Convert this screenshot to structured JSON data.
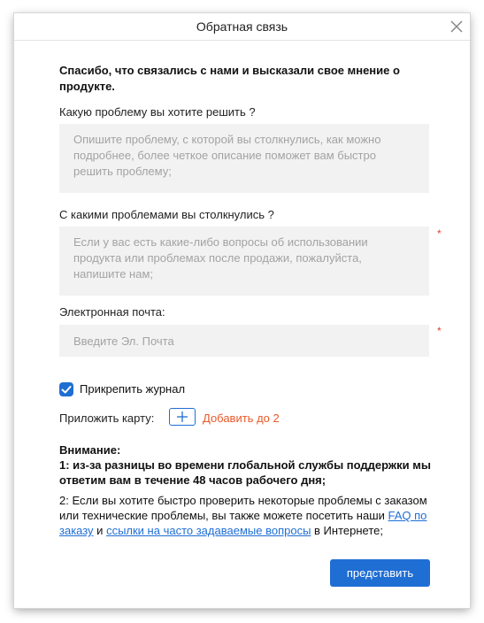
{
  "window": {
    "title": "Обратная связь",
    "close_icon": "close-icon"
  },
  "form": {
    "intro": "Спасибо, что связались с нами и высказали свое мнение о продукте.",
    "q1": {
      "label": "Какую проблему вы хотите решить ?",
      "value": "",
      "placeholder": "Опишите проблему, с которой вы столкнулись, как можно подробнее, более четкое описание поможет вам быстро решить проблему;"
    },
    "q2": {
      "label": "С какими проблемами вы столкнулись ?",
      "value": "",
      "placeholder": "Если у вас есть какие-либо вопросы об использовании продукта или проблемах после продажи, пожалуйста, напишите нам;",
      "required_mark": "*"
    },
    "email": {
      "label": "Электронная почта:",
      "value": "",
      "placeholder": "Введите Эл. Почта",
      "required_mark": "*"
    },
    "attach_log": {
      "label": "Прикрепить журнал",
      "checked": true
    },
    "attach_image": {
      "label": "Приложить карту:",
      "add_label": "Добавить до 2",
      "plus_icon": "plus-icon"
    }
  },
  "notice": {
    "heading": "Внимание:",
    "line1": "1: из-за разницы во времени глобальной службы поддержки мы ответим вам в течение 48 часов рабочего дня;",
    "line2_prefix": "2: Если вы хотите быстро проверить некоторые проблемы с заказом или технические проблемы, вы также можете посетить наши ",
    "link1": "FAQ по заказу",
    "between": " и ",
    "link2": "ссылки на часто задаваемые вопросы",
    "line2_suffix": " в Интернете;"
  },
  "submit_label": "представить",
  "colors": {
    "accent": "#1f6ed4",
    "required": "#e8402a",
    "add": "#e8592a",
    "field_bg": "#f2f2f2"
  }
}
